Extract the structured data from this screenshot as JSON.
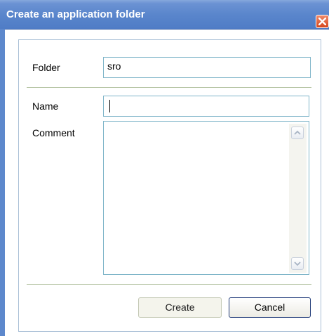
{
  "window": {
    "title": "Create an application folder",
    "close_icon": "close-icon"
  },
  "form": {
    "folder_label": "Folder",
    "folder_value": "sro",
    "name_label": "Name",
    "name_value": "",
    "comment_label": "Comment",
    "comment_value": ""
  },
  "buttons": {
    "create": "Create",
    "cancel": "Cancel"
  },
  "colors": {
    "titlebar": "#5a86cc",
    "field_border": "#7fb5c9",
    "cancel_border": "#1f3a78"
  }
}
